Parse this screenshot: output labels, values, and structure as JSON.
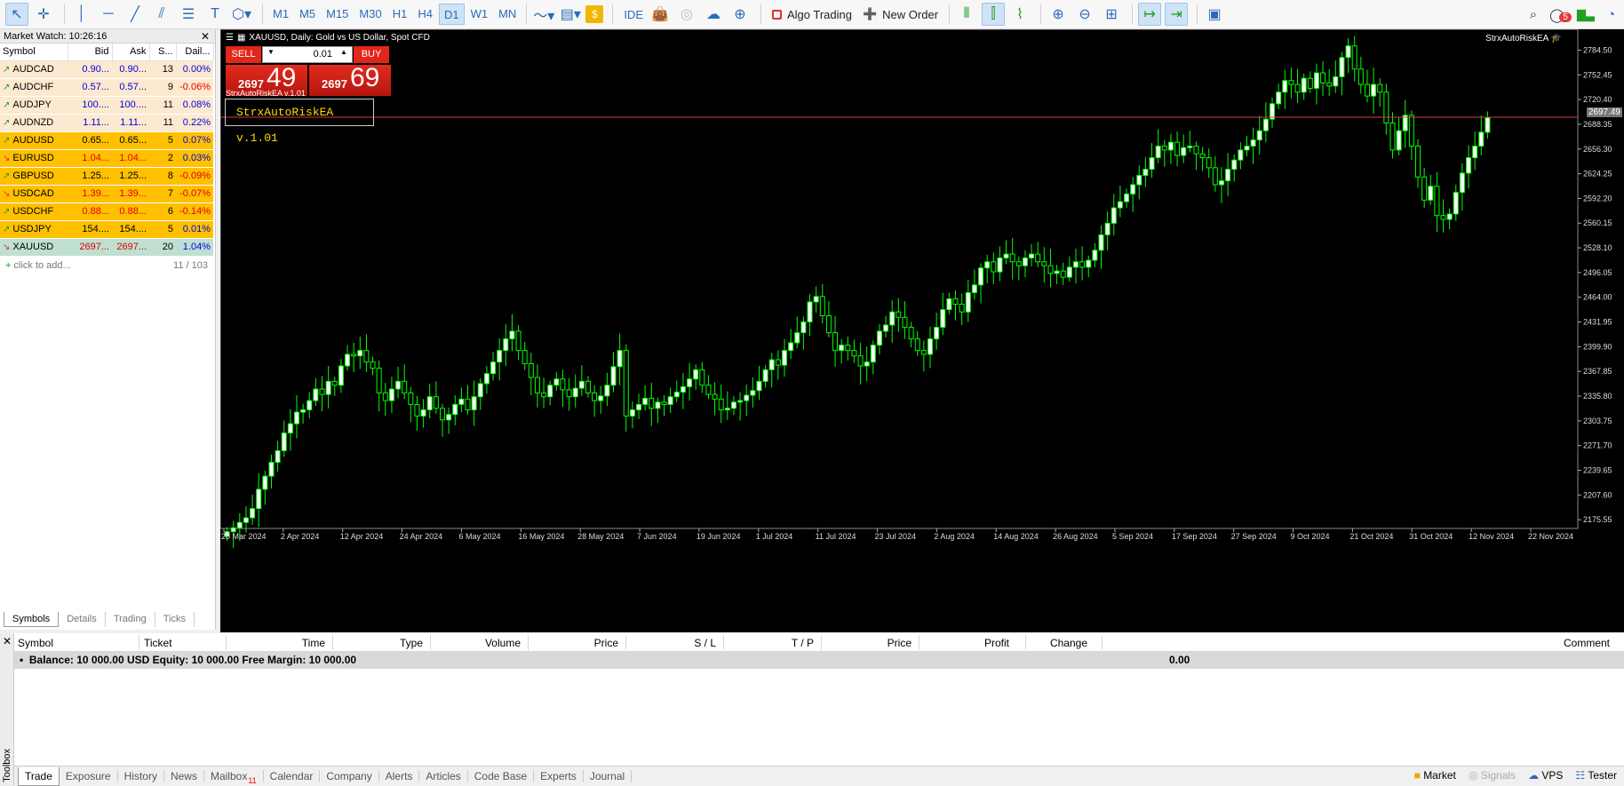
{
  "toolbar": {
    "timeframes": [
      "M1",
      "M5",
      "M15",
      "M30",
      "H1",
      "H4",
      "D1",
      "W1",
      "MN"
    ],
    "active_timeframe": "D1",
    "ide_label": "IDE",
    "algo_trading_label": "Algo Trading",
    "new_order_label": "New Order",
    "notification_count": "5"
  },
  "market_watch": {
    "title": "Market Watch: 10:26:16",
    "columns": [
      "Symbol",
      "Bid",
      "Ask",
      "S...",
      "Dail..."
    ],
    "rows": [
      {
        "symbol": "AUDCAD",
        "bid": "0.90...",
        "ask": "0.90...",
        "spread": "13",
        "daily": "0.00%"
      },
      {
        "symbol": "AUDCHF",
        "bid": "0.57...",
        "ask": "0.57...",
        "spread": "9",
        "daily": "-0.06%"
      },
      {
        "symbol": "AUDJPY",
        "bid": "100....",
        "ask": "100....",
        "spread": "11",
        "daily": "0.08%"
      },
      {
        "symbol": "AUDNZD",
        "bid": "1.11...",
        "ask": "1.11...",
        "spread": "11",
        "daily": "0.22%"
      },
      {
        "symbol": "AUDUSD",
        "bid": "0.65...",
        "ask": "0.65...",
        "spread": "5",
        "daily": "0.07%"
      },
      {
        "symbol": "EURUSD",
        "bid": "1.04...",
        "ask": "1.04...",
        "spread": "2",
        "daily": "0.03%"
      },
      {
        "symbol": "GBPUSD",
        "bid": "1.25...",
        "ask": "1.25...",
        "spread": "8",
        "daily": "-0.09%"
      },
      {
        "symbol": "USDCAD",
        "bid": "1.39...",
        "ask": "1.39...",
        "spread": "7",
        "daily": "-0.07%"
      },
      {
        "symbol": "USDCHF",
        "bid": "0.88...",
        "ask": "0.88...",
        "spread": "6",
        "daily": "-0.14%"
      },
      {
        "symbol": "USDJPY",
        "bid": "154....",
        "ask": "154....",
        "spread": "5",
        "daily": "0.01%"
      },
      {
        "symbol": "XAUUSD",
        "bid": "2697...",
        "ask": "2697...",
        "spread": "20",
        "daily": "1.04%"
      }
    ],
    "add_label": "click to add...",
    "count": "11 / 103",
    "tabs": [
      "Symbols",
      "Details",
      "Trading",
      "Ticks"
    ]
  },
  "chart": {
    "header": "XAUUSD, Daily:  Gold vs US Dollar, Spot CFD",
    "ea_name": "StrxAutoRiskEA",
    "sell_label": "SELL",
    "buy_label": "BUY",
    "lot": "0.01",
    "sell_small": "2697",
    "sell_big": "49",
    "buy_small": "2697",
    "buy_big": "69",
    "ea_sub": "StrxAutoRiskEA v.1.01",
    "ea_box": "StrxAutoRiskEA v.1.01",
    "current_price": "2697.49"
  },
  "chart_data": {
    "type": "candlestick",
    "price_axis_ticks": [
      "2784.50",
      "2752.45",
      "2720.40",
      "2688.35",
      "2656.30",
      "2624.25",
      "2592.20",
      "2560.15",
      "2528.10",
      "2496.05",
      "2464.00",
      "2431.95",
      "2399.90",
      "2367.85",
      "2335.80",
      "2303.75",
      "2271.70",
      "2239.65",
      "2207.60",
      "2175.55"
    ],
    "time_axis_ticks": [
      "20 Mar 2024",
      "2 Apr 2024",
      "12 Apr 2024",
      "24 Apr 2024",
      "6 May 2024",
      "16 May 2024",
      "28 May 2024",
      "7 Jun 2024",
      "19 Jun 2024",
      "1 Jul 2024",
      "11 Jul 2024",
      "23 Jul 2024",
      "2 Aug 2024",
      "14 Aug 2024",
      "26 Aug 2024",
      "5 Sep 2024",
      "17 Sep 2024",
      "27 Sep 2024",
      "9 Oct 2024",
      "21 Oct 2024",
      "31 Oct 2024",
      "12 Nov 2024",
      "22 Nov 2024"
    ],
    "ylim": [
      2155,
      2800
    ],
    "bullish_color": "#ffffff",
    "bearish_color": "#000000",
    "wick_color": "#00ff00",
    "price_line": 2697.49,
    "close": [
      2160,
      2165,
      2172,
      2178,
      2190,
      2215,
      2232,
      2250,
      2265,
      2288,
      2300,
      2315,
      2318,
      2330,
      2345,
      2338,
      2355,
      2350,
      2375,
      2390,
      2388,
      2395,
      2380,
      2372,
      2340,
      2330,
      2345,
      2355,
      2340,
      2325,
      2310,
      2318,
      2335,
      2320,
      2305,
      2312,
      2325,
      2332,
      2318,
      2335,
      2352,
      2365,
      2380,
      2395,
      2410,
      2420,
      2395,
      2378,
      2360,
      2340,
      2335,
      2350,
      2358,
      2344,
      2335,
      2346,
      2355,
      2340,
      2330,
      2336,
      2350,
      2374,
      2395,
      2310,
      2318,
      2325,
      2333,
      2320,
      2328,
      2325,
      2335,
      2341,
      2348,
      2358,
      2370,
      2350,
      2338,
      2332,
      2318,
      2320,
      2328,
      2330,
      2337,
      2343,
      2355,
      2370,
      2383,
      2376,
      2395,
      2405,
      2418,
      2432,
      2458,
      2465,
      2440,
      2418,
      2395,
      2402,
      2395,
      2388,
      2375,
      2380,
      2402,
      2420,
      2428,
      2445,
      2438,
      2425,
      2410,
      2395,
      2390,
      2410,
      2425,
      2448,
      2462,
      2455,
      2445,
      2470,
      2480,
      2502,
      2510,
      2497,
      2515,
      2520,
      2510,
      2505,
      2515,
      2520,
      2510,
      2505,
      2495,
      2498,
      2490,
      2503,
      2510,
      2503,
      2512,
      2525,
      2545,
      2560,
      2580,
      2588,
      2598,
      2610,
      2622,
      2630,
      2645,
      2660,
      2655,
      2665,
      2648,
      2658,
      2660,
      2650,
      2645,
      2632,
      2610,
      2615,
      2630,
      2642,
      2655,
      2660,
      2668,
      2680,
      2695,
      2715,
      2730,
      2745,
      2740,
      2730,
      2748,
      2735,
      2755,
      2742,
      2738,
      2750,
      2775,
      2790,
      2760,
      2740,
      2725,
      2740,
      2730,
      2690,
      2655,
      2680,
      2700,
      2660,
      2620,
      2590,
      2608,
      2570,
      2565,
      2572,
      2600,
      2625,
      2645,
      2660,
      2678,
      2697
    ]
  },
  "toolbox": {
    "title": "Toolbox",
    "columns": [
      "Symbol",
      "Ticket",
      "Time",
      "Type",
      "Volume",
      "Price",
      "S / L",
      "T / P",
      "Price",
      "Profit",
      "Change",
      "Comment"
    ],
    "balance_text": "Balance: 10 000.00 USD  Equity: 10 000.00  Free Margin: 10 000.00",
    "profit": "0.00",
    "tabs": [
      "Trade",
      "Exposure",
      "History",
      "News",
      "Mailbox",
      "Calendar",
      "Company",
      "Alerts",
      "Articles",
      "Code Base",
      "Experts",
      "Journal"
    ],
    "mailbox_badge": "11",
    "status_items": [
      "Market",
      "Signals",
      "VPS",
      "Tester"
    ]
  }
}
